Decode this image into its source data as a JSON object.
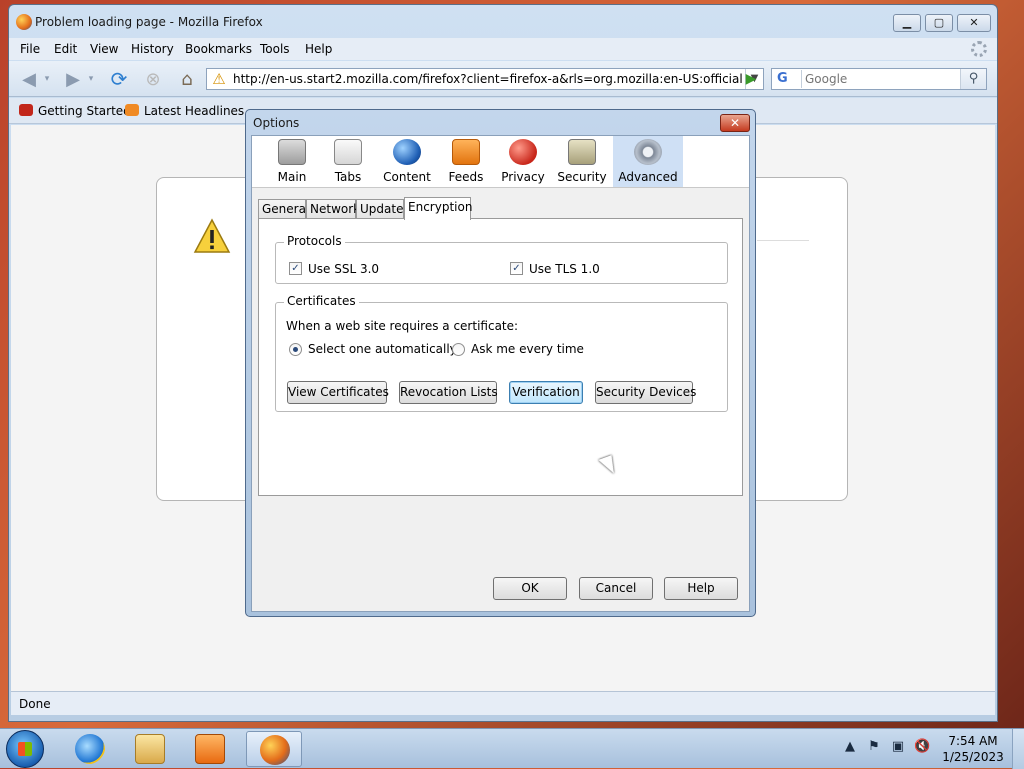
{
  "window": {
    "title": "Problem loading page - Mozilla Firefox",
    "controls": {
      "minimize": "▁",
      "maximize": "▢",
      "close": "✕"
    }
  },
  "menu": [
    "File",
    "Edit",
    "View",
    "History",
    "Bookmarks",
    "Tools",
    "Help"
  ],
  "nav": {
    "url": "http://en-us.start2.mozilla.com/firefox?client=firefox-a&rls=org.mozilla:en-US:official",
    "search_placeholder": "Google",
    "search_engine": "G"
  },
  "bookmarks": [
    "Getting Started",
    "Latest Headlines"
  ],
  "status": "Done",
  "dialog": {
    "title": "Options",
    "panes": [
      "Main",
      "Tabs",
      "Content",
      "Feeds",
      "Privacy",
      "Security",
      "Advanced"
    ],
    "active_pane": "Advanced",
    "tabs": [
      "General",
      "Network",
      "Update",
      "Encryption"
    ],
    "active_tab": "Encryption",
    "protocols": {
      "label": "Protocols",
      "ssl": {
        "label": "Use SSL 3.0",
        "checked": true
      },
      "tls": {
        "label": "Use TLS 1.0",
        "checked": true
      }
    },
    "certificates": {
      "label": "Certificates",
      "prompt": "When a web site requires a certificate:",
      "option_auto": "Select one automatically",
      "option_ask": "Ask me every time",
      "selected": "auto",
      "buttons": [
        "View Certificates",
        "Revocation Lists",
        "Verification",
        "Security Devices"
      ]
    },
    "buttons": {
      "ok": "OK",
      "cancel": "Cancel",
      "help": "Help"
    }
  },
  "taskbar": {
    "time": "7:54 AM",
    "date": "1/25/2023"
  },
  "colors": {
    "accent": "#2b4a7a",
    "pane_active": "#cfe0f5",
    "warning": "#d59000"
  }
}
